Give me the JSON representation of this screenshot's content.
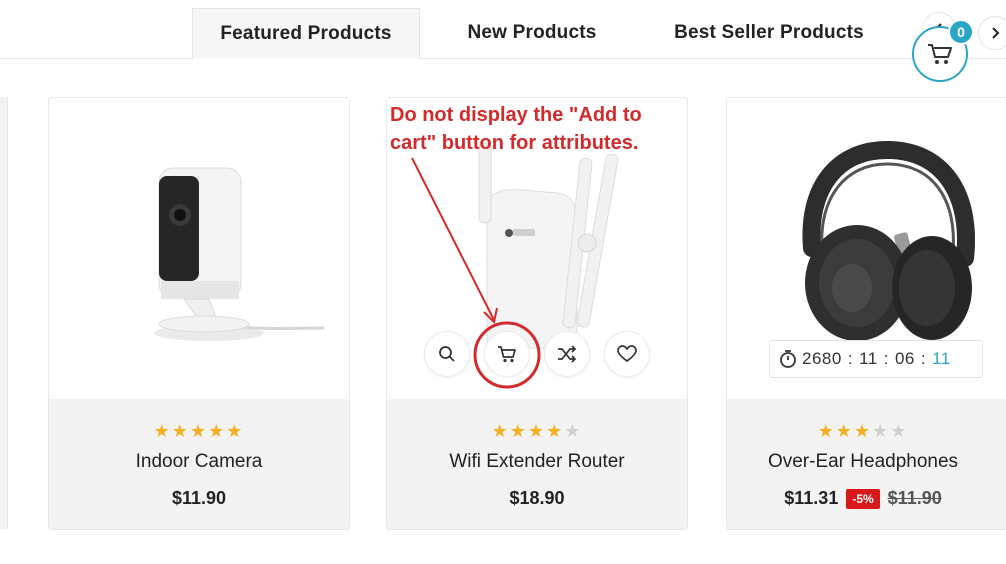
{
  "tabs": [
    {
      "label": "Featured Products",
      "active": true
    },
    {
      "label": "New Products",
      "active": false
    },
    {
      "label": "Best Seller Products",
      "active": false
    }
  ],
  "cart": {
    "count": "0",
    "icon": "cart-icon"
  },
  "annotation": {
    "line1": "Do not display the \"Add to",
    "line2": "cart\" button for attributes."
  },
  "products": [
    {
      "name": "Indoor Camera",
      "price": "$11.90",
      "rating": 5
    },
    {
      "name": "Wifi Extender Router",
      "price": "$18.90",
      "rating": 4
    },
    {
      "name": "Over-Ear Headphones",
      "price": "$11.31",
      "discount": "-5%",
      "old_price": "$11.90",
      "rating": 3,
      "countdown": {
        "days": "2680",
        "hours": "11",
        "minutes": "06",
        "seconds": "11"
      }
    }
  ],
  "colors": {
    "accent": "#2aa5c4",
    "star": "#f2b01e",
    "annotation": "#d32b2b",
    "sale": "#d71919"
  }
}
